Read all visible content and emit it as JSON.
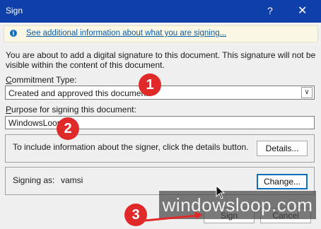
{
  "window": {
    "title": "Sign",
    "help_glyph": "?",
    "close_glyph": "✕"
  },
  "info_bar": {
    "link_text": "See additional information about what you are signing..."
  },
  "intro_text": "You are about to add a digital signature to this document. This signature will not be visible within the content of this document.",
  "commitment": {
    "label_accesskey": "C",
    "label_rest": "ommitment Type:",
    "selected_value": "Created and approved this document"
  },
  "purpose": {
    "label_accesskey": "P",
    "label_rest": "urpose for signing this document:",
    "value": "WindowsLoop"
  },
  "details_group": {
    "text": "To include information about the signer, click the details button.",
    "button_label": "Details..."
  },
  "signer_group": {
    "signing_as_label": "Signing as:",
    "signer_name": "vamsi",
    "change_button_label": "Change..."
  },
  "footer": {
    "sign_label": "Sign",
    "cancel_label": "Cancel"
  },
  "annotations": {
    "badge1": "1",
    "badge2": "2",
    "badge3": "3",
    "watermark": "windowsloop.com"
  },
  "colors": {
    "titlebar": "#0f3fa8",
    "badge": "#e02a2a",
    "accent": "#0f6fbf",
    "link": "#0b5ca8"
  }
}
